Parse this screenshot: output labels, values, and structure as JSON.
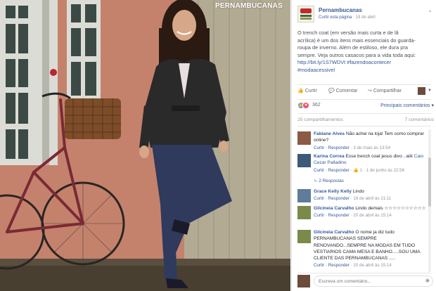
{
  "photo": {
    "watermark": "PERNAMBUCANAS"
  },
  "post": {
    "page_name": "Pernambucanas",
    "follow_label": "Curtir esta página",
    "date": "19 de abril",
    "text_lines": [
      "O trench coat (em versão mais curta e de lã",
      "acrílica) é um dos itens mais essenciais do guarda-",
      "roupa de inverno. Além de estiloso, ele dura pra",
      "sempre. Veja outros casacos para a vida toda aqui:"
    ],
    "link": "http://bit.ly/1S7WDVt #fazendoacontecer",
    "hashtag": "#modaacessivel"
  },
  "actions": {
    "like": "Curtir",
    "comment": "Comentar",
    "share": "Compartilhar"
  },
  "reactions": {
    "count": "362",
    "sort_label": "Principais comentários"
  },
  "stats": {
    "shares": "25 compartilhamentos",
    "comments": "7 comentários"
  },
  "comments": [
    {
      "name": "Fabiane Alves",
      "text": "Não achei na loja! Tem como comprar online?",
      "actions": "Curtir · Responder",
      "time": "3 de maio às 13:54"
    },
    {
      "name": "Karina Correa",
      "text": "Esse trench coat jesus divo , aiiii",
      "mention": "Caio Cezar Palladino",
      "actions": "Curtir · Responder",
      "likes": "1",
      "time": "1 de junho às 22:56",
      "replies": "2 Respostas"
    },
    {
      "name": "Grace Kelly Kelly",
      "text": "Lindo",
      "actions": "Curtir · Responder",
      "time": "19 de abril às 21:11"
    },
    {
      "name": "Gilcineia Carvalho",
      "text": "Lindo demais ☆☆☆☆☆☆☆☆☆☆",
      "actions": "Curtir · Responder",
      "time": "20 de abril às 15:14"
    },
    {
      "name": "Gilcineia Carvalho",
      "text": "O nome ja diz tudo PERNAMBUCANAS SEMPRE RENOVANDO...SEMPRE NA MODAS EM TUDO VESTIARIOS CAMA MESA E BANHO.....SOU UMA CLIENTE DAS PERNAMBUCANAS .....",
      "actions": "Curtir · Responder",
      "time": "20 de abril às 15:14"
    }
  ],
  "composer": {
    "placeholder": "Escreva um comentário..."
  },
  "colors": {
    "link": "#365899",
    "meta": "#90949c",
    "like_reaction": "#5890ff",
    "love_reaction": "#f25268"
  }
}
